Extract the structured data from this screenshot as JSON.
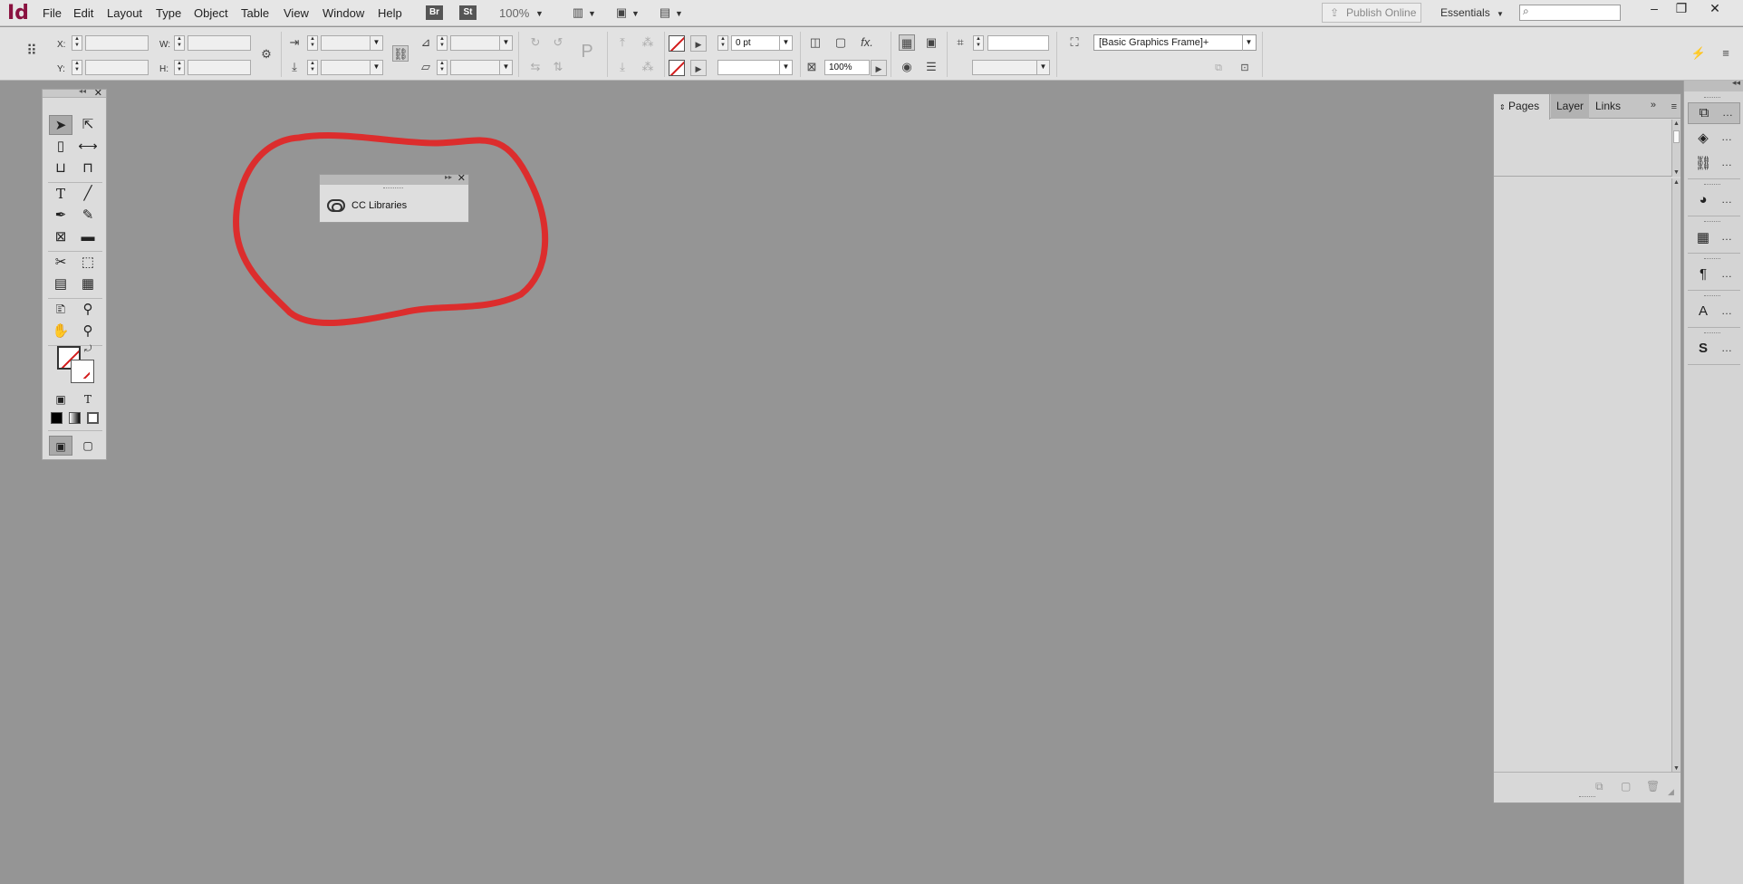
{
  "app": {
    "logo": "Id"
  },
  "menu": [
    "File",
    "Edit",
    "Layout",
    "Type",
    "Object",
    "Table",
    "View",
    "Window",
    "Help"
  ],
  "app_buttons": {
    "bridge": "Br",
    "stock": "St"
  },
  "zoom_level": "100%",
  "publish_label": "Publish Online",
  "workspace_label": "Essentials",
  "search": {
    "value": ""
  },
  "control": {
    "x_label": "X:",
    "y_label": "Y:",
    "w_label": "W:",
    "h_label": "H:",
    "stroke_weight": "0 pt",
    "opacity": "100%",
    "object_style": "[Basic Graphics Frame]+"
  },
  "cc_panel": {
    "title": "CC Libraries"
  },
  "pages_panel": {
    "tabs": [
      "Pages",
      "Layer",
      "Links"
    ]
  },
  "colors": {
    "accent_red": "#d21b1b",
    "app_logo": "#8a1240",
    "pasteboard": "#959595"
  }
}
